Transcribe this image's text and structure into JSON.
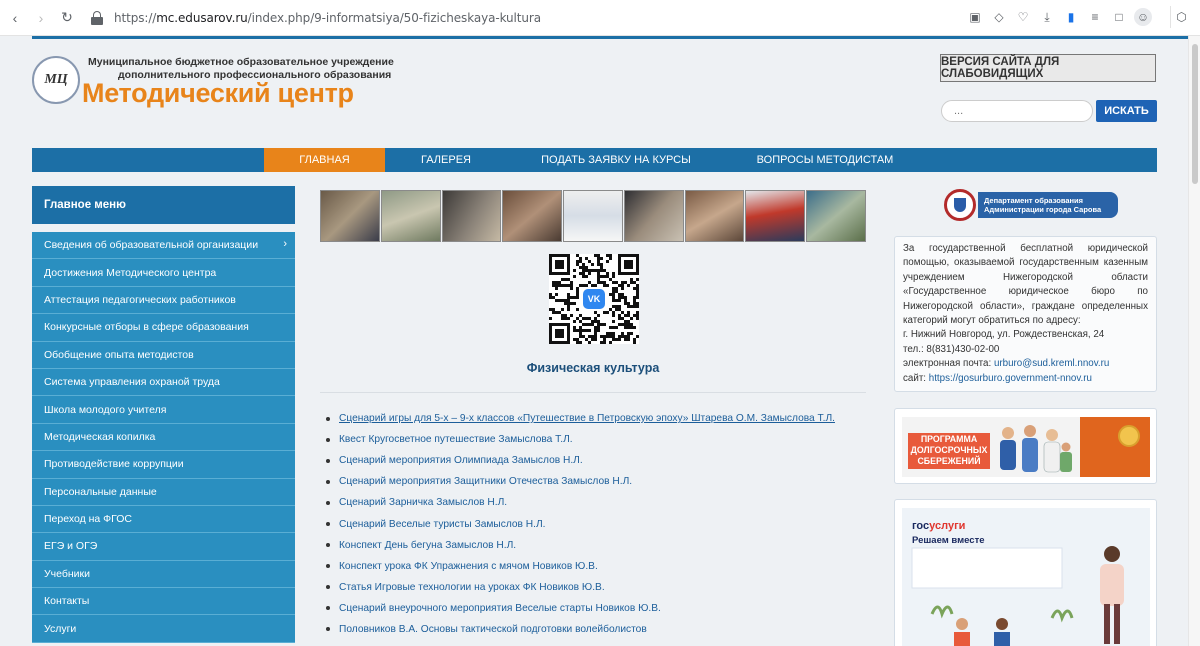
{
  "browser": {
    "url_prefix": "https://",
    "url_host": "mc.edusarov.ru",
    "url_path": "/index.php/9-informatsiya/50-fizicheskaya-kultura"
  },
  "header": {
    "org_line1": "Муниципальное бюджетное образовательное учреждение",
    "org_line2": "дополнительного профессионального образования",
    "brand": "Методический центр",
    "logo_text": "МЦ",
    "low_vision_label": "ВЕРСИЯ САЙТА ДЛЯ СЛАБОВИДЯЩИХ",
    "search_placeholder": "...",
    "search_button": "ИСКАТЬ"
  },
  "topnav": {
    "items": [
      {
        "label": "ГЛАВНАЯ"
      },
      {
        "label": "ГАЛЕРЕЯ"
      },
      {
        "label": "ПОДАТЬ ЗАЯВКУ НА КУРСЫ"
      },
      {
        "label": "ВОПРОСЫ МЕТОДИСТАМ"
      }
    ]
  },
  "sidebar": {
    "title": "Главное меню",
    "items": [
      {
        "label": "Сведения об образовательной организации"
      },
      {
        "label": "Достижения Методического центра"
      },
      {
        "label": "Аттестация педагогических работников"
      },
      {
        "label": "Конкурсные отборы в сфере образования"
      },
      {
        "label": "Обобщение опыта методистов"
      },
      {
        "label": "Система управления охраной труда"
      },
      {
        "label": "Школа молодого учителя"
      },
      {
        "label": "Методическая копилка"
      },
      {
        "label": "Противодействие коррупции"
      },
      {
        "label": "Персональные данные"
      },
      {
        "label": "Переход на ФГОС"
      },
      {
        "label": "ЕГЭ и ОГЭ"
      },
      {
        "label": "Учебники"
      },
      {
        "label": "Контакты"
      },
      {
        "label": "Услуги"
      }
    ]
  },
  "main": {
    "qr_badge": "VK",
    "title": "Физическая культура",
    "links": [
      {
        "text": "Сценарий игры для 5-х – 9-х классов «Путешествие в Петровскую эпоху» Штарева О.М. Замыслова Т.Л."
      },
      {
        "text": "Квест Кругосветное путешествие Замыслова Т.Л."
      },
      {
        "text": "Сценарий мероприятия Олимпиада Замыслов Н.Л."
      },
      {
        "text": "Сценарий мероприятия Защитники Отечества Замыслов Н.Л."
      },
      {
        "text": "Сценарий Зарничка Замыслов Н.Л."
      },
      {
        "text": "Сценарий Веселые туристы Замыслов Н.Л."
      },
      {
        "text": "Конспект День бегуна Замыслов Н.Л."
      },
      {
        "text": "Конспект урока ФК Упражнения с мячом Новиков Ю.В."
      },
      {
        "text": "Статья Игровые технологии на уроках ФК Новиков Ю.В."
      },
      {
        "text": "Сценарий внеурочного мероприятия Веселые старты Новиков Ю.В."
      },
      {
        "text": "Половников В.А. Основы тактической подготовки волейболистов"
      }
    ]
  },
  "right": {
    "dept_line1": "Департамент образования",
    "dept_line2": "Администрации города Сарова",
    "info_text": "За государственной бесплатной юридической помощью, оказываемой государственным казенным учреждением Нижегородской области «Государственное юридическое бюро по Нижегородской области», граждане определенных категорий могут обратиться по адресу:",
    "address": "г. Нижний Новгород, ул. Рождественская, 24",
    "phone": "тел.: 8(831)430-02-00",
    "email_label": "электронная почта: ",
    "email": "urburo@sud.kreml.nnov.ru",
    "site_label": "сайт: ",
    "site": "https://gosurburo.government-nnov.ru",
    "promo_line1": "ПРОГРАММА",
    "promo_line2": "ДОЛГОСРОЧНЫХ",
    "promo_line3": "СБЕРЕЖЕНИЙ",
    "gos_part1": "гос",
    "gos_part2": "услуги",
    "gos_sub": "Решаем вместе"
  },
  "colors": {
    "primary_blue": "#1c6fa6",
    "sidebar_blue": "#2a8fc0",
    "accent_orange": "#e8841a",
    "search_blue": "#1e63b5"
  }
}
